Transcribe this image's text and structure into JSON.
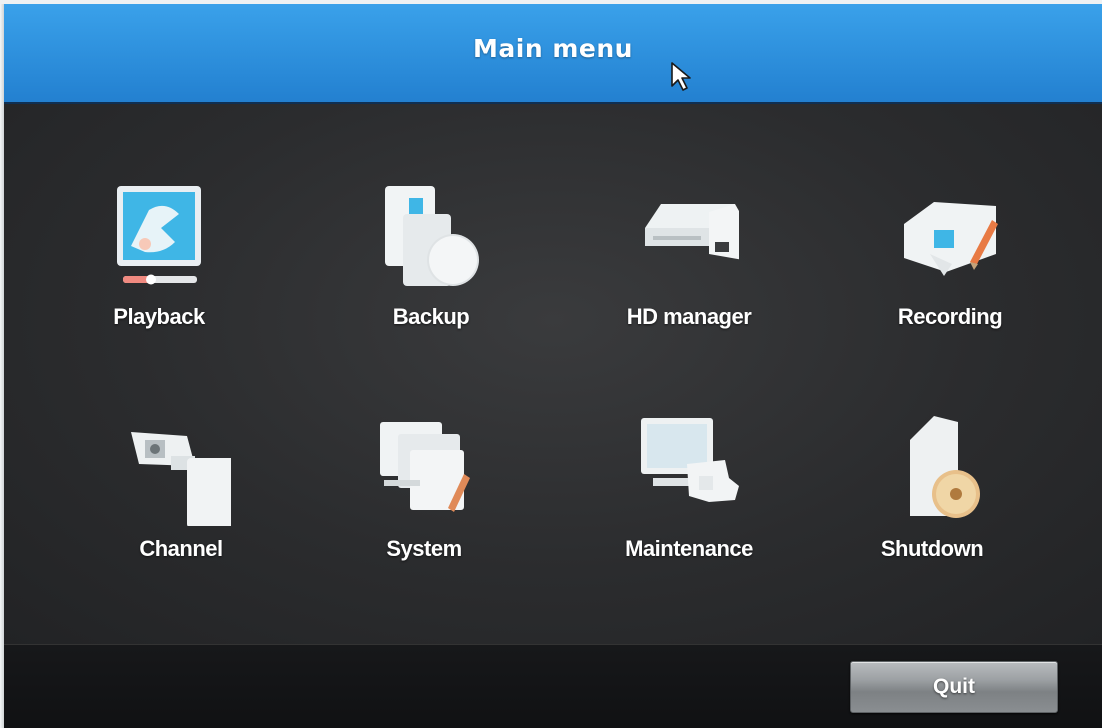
{
  "window": {
    "title": "Main menu"
  },
  "menu": {
    "items": [
      {
        "label": "Playback",
        "icon": "playback-monitor-icon"
      },
      {
        "label": "Backup",
        "icon": "backup-disc-icon"
      },
      {
        "label": "HD manager",
        "icon": "hard-drive-icon"
      },
      {
        "label": "Recording",
        "icon": "recording-camera-icon"
      },
      {
        "label": "Channel",
        "icon": "camera-channel-icon"
      },
      {
        "label": "System",
        "icon": "system-settings-icon"
      },
      {
        "label": "Maintenance",
        "icon": "maintenance-icon"
      },
      {
        "label": "Shutdown",
        "icon": "shutdown-icon"
      }
    ]
  },
  "footer": {
    "quit_label": "Quit"
  },
  "colors": {
    "titlebar": "#2d8fdc",
    "background": "#2b2c2e",
    "text": "#ffffff"
  }
}
